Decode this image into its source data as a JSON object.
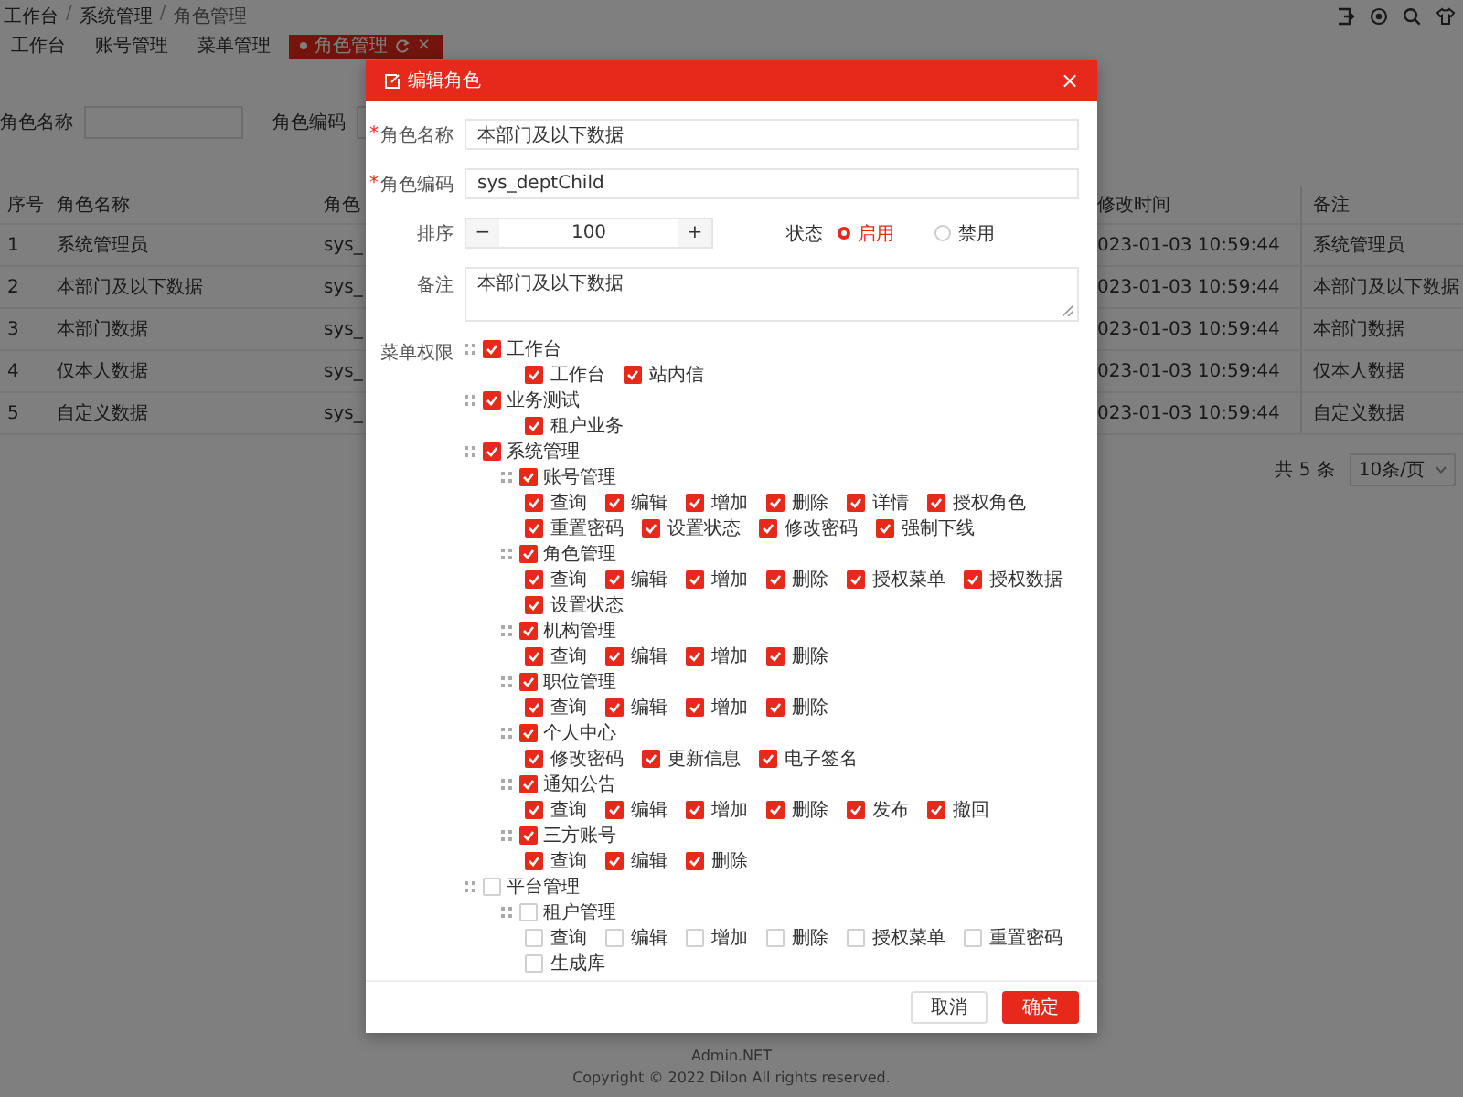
{
  "breadcrumb": [
    {
      "kind": "link",
      "text": "工作台"
    },
    {
      "kind": "separator",
      "text": "/"
    },
    {
      "kind": "link",
      "text": "系统管理"
    },
    {
      "kind": "separator",
      "text": "/"
    },
    {
      "kind": "current",
      "text": "角色管理"
    }
  ],
  "tabs": [
    {
      "label": "工作台",
      "selected": false
    },
    {
      "label": "账号管理",
      "selected": false
    },
    {
      "label": "菜单管理",
      "selected": false
    },
    {
      "label": "角色管理",
      "selected": true,
      "close": "×"
    }
  ],
  "search": [
    {
      "label": "角色名称"
    },
    {
      "label": "角色编码"
    }
  ],
  "table": {
    "columns": [
      "序号",
      "角色名称",
      "角色",
      "修改时间",
      "备注"
    ],
    "rows": [
      [
        "1",
        "系统管理员",
        "sys_",
        "023-01-03 10:59:44",
        "系统管理员"
      ],
      [
        "2",
        "本部门及以下数据",
        "sys_",
        "023-01-03 10:59:44",
        "本部门及以下数据"
      ],
      [
        "3",
        "本部门数据",
        "sys_",
        "023-01-03 10:59:44",
        "本部门数据"
      ],
      [
        "4",
        "仅本人数据",
        "sys_",
        "023-01-03 10:59:44",
        "仅本人数据"
      ],
      [
        "5",
        "自定义数据",
        "sys_",
        "023-01-03 10:59:44",
        "自定义数据"
      ]
    ]
  },
  "pagination": {
    "total": "共 5 条",
    "page_size": "10条/页"
  },
  "footer": {
    "title": "Admin.NET",
    "copyright": "Copyright © 2022 Dilon All rights reserved."
  },
  "dialog": {
    "title": "编辑角色",
    "close": "×",
    "fields": [
      {
        "label": "角色名称",
        "required_mark": "*",
        "value": "本部门及以下数据"
      },
      {
        "label": "角色编码",
        "required_mark": "*",
        "value": "sys_deptChild"
      }
    ],
    "order": {
      "label": "排序",
      "minus": "−",
      "value": "100",
      "plus": "+"
    },
    "status": {
      "label": "状态",
      "options": [
        {
          "label": "启用",
          "selected": true
        },
        {
          "label": "禁用",
          "selected": false
        }
      ]
    },
    "remark": {
      "label": "备注",
      "value": "本部门及以下数据"
    },
    "menu": {
      "label": "菜单权限",
      "tree": [
        {
          "label": "工作台",
          "checked": true,
          "children": [
            {
              "label": "工作台",
              "checked": true
            },
            {
              "label": "站内信",
              "checked": true
            }
          ]
        },
        {
          "label": "业务测试",
          "checked": true,
          "children": [
            {
              "label": "租户业务",
              "checked": true
            }
          ]
        },
        {
          "label": "系统管理",
          "checked": true,
          "children": [
            {
              "label": "账号管理",
              "checked": true,
              "children": [
                {
                  "label": "查询",
                  "checked": true
                },
                {
                  "label": "编辑",
                  "checked": true
                },
                {
                  "label": "增加",
                  "checked": true
                },
                {
                  "label": "删除",
                  "checked": true
                },
                {
                  "label": "详情",
                  "checked": true
                },
                {
                  "label": "授权角色",
                  "checked": true
                },
                {
                  "label": "重置密码",
                  "checked": true
                },
                {
                  "label": "设置状态",
                  "checked": true
                },
                {
                  "label": "修改密码",
                  "checked": true
                },
                {
                  "label": "强制下线",
                  "checked": true
                }
              ]
            },
            {
              "label": "角色管理",
              "checked": true,
              "children": [
                {
                  "label": "查询",
                  "checked": true
                },
                {
                  "label": "编辑",
                  "checked": true
                },
                {
                  "label": "增加",
                  "checked": true
                },
                {
                  "label": "删除",
                  "checked": true
                },
                {
                  "label": "授权菜单",
                  "checked": true
                },
                {
                  "label": "授权数据",
                  "checked": true
                },
                {
                  "label": "设置状态",
                  "checked": true
                }
              ]
            },
            {
              "label": "机构管理",
              "checked": true,
              "children": [
                {
                  "label": "查询",
                  "checked": true
                },
                {
                  "label": "编辑",
                  "checked": true
                },
                {
                  "label": "增加",
                  "checked": true
                },
                {
                  "label": "删除",
                  "checked": true
                }
              ]
            },
            {
              "label": "职位管理",
              "checked": true,
              "children": [
                {
                  "label": "查询",
                  "checked": true
                },
                {
                  "label": "编辑",
                  "checked": true
                },
                {
                  "label": "增加",
                  "checked": true
                },
                {
                  "label": "删除",
                  "checked": true
                }
              ]
            },
            {
              "label": "个人中心",
              "checked": true,
              "children": [
                {
                  "label": "修改密码",
                  "checked": true
                },
                {
                  "label": "更新信息",
                  "checked": true
                },
                {
                  "label": "电子签名",
                  "checked": true
                }
              ]
            },
            {
              "label": "通知公告",
              "checked": true,
              "children": [
                {
                  "label": "查询",
                  "checked": true
                },
                {
                  "label": "编辑",
                  "checked": true
                },
                {
                  "label": "增加",
                  "checked": true
                },
                {
                  "label": "删除",
                  "checked": true
                },
                {
                  "label": "发布",
                  "checked": true
                },
                {
                  "label": "撤回",
                  "checked": true
                }
              ]
            },
            {
              "label": "三方账号",
              "checked": true,
              "children": [
                {
                  "label": "查询",
                  "checked": true
                },
                {
                  "label": "编辑",
                  "checked": true
                },
                {
                  "label": "删除",
                  "checked": true
                }
              ]
            }
          ]
        },
        {
          "label": "平台管理",
          "checked": false,
          "children": [
            {
              "label": "租户管理",
              "checked": false,
              "children": [
                {
                  "label": "查询",
                  "checked": false
                },
                {
                  "label": "编辑",
                  "checked": false
                },
                {
                  "label": "增加",
                  "checked": false
                },
                {
                  "label": "删除",
                  "checked": false
                },
                {
                  "label": "授权菜单",
                  "checked": false
                },
                {
                  "label": "重置密码",
                  "checked": false
                },
                {
                  "label": "生成库",
                  "checked": false
                }
              ]
            }
          ]
        }
      ]
    },
    "buttons": [
      {
        "label": "取消",
        "kind": "default"
      },
      {
        "label": "确定",
        "kind": "primary"
      }
    ]
  }
}
